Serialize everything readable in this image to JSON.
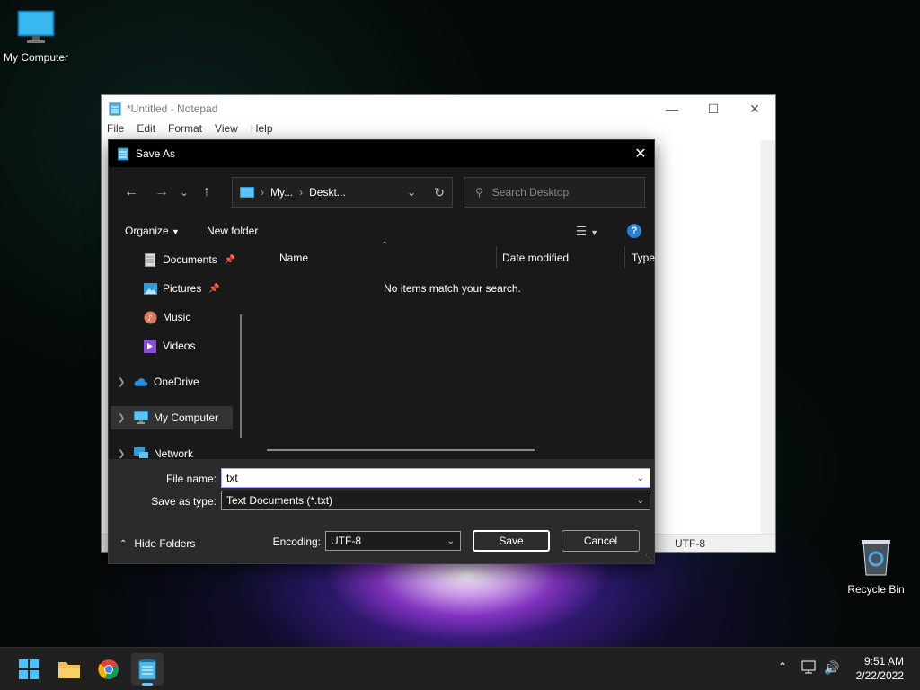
{
  "desktop": {
    "icons": [
      {
        "label": "My Computer"
      },
      {
        "label": "Recycle Bin"
      }
    ]
  },
  "notepad": {
    "title": "*Untitled - Notepad",
    "menu": [
      "File",
      "Edit",
      "Format",
      "View",
      "Help"
    ],
    "status_encoding": "UTF-8"
  },
  "dialog": {
    "title": "Save As",
    "breadcrumb": [
      "My...",
      "Deskt..."
    ],
    "search_placeholder": "Search Desktop",
    "organize_label": "Organize",
    "new_folder_label": "New folder",
    "nav_items": [
      {
        "label": "Documents",
        "pinned": true
      },
      {
        "label": "Pictures",
        "pinned": true
      },
      {
        "label": "Music"
      },
      {
        "label": "Videos"
      },
      {
        "label": "OneDrive"
      },
      {
        "label": "My Computer"
      },
      {
        "label": "Network"
      }
    ],
    "columns": [
      "Name",
      "Date modified",
      "Type"
    ],
    "empty_message": "No items match your search.",
    "file_name_label": "File name:",
    "file_name_value": "txt",
    "save_type_label": "Save as type:",
    "save_type_value": "Text Documents (*.txt)",
    "hide_folders_label": "Hide Folders",
    "encoding_label": "Encoding:",
    "encoding_value": "UTF-8",
    "save_label": "Save",
    "cancel_label": "Cancel"
  },
  "taskbar": {
    "time": "9:51 AM",
    "date": "2/22/2022"
  },
  "colors": {
    "accent": "#2a7fd4",
    "dialog_bg": "#191919",
    "taskbar_bg": "#202020"
  }
}
